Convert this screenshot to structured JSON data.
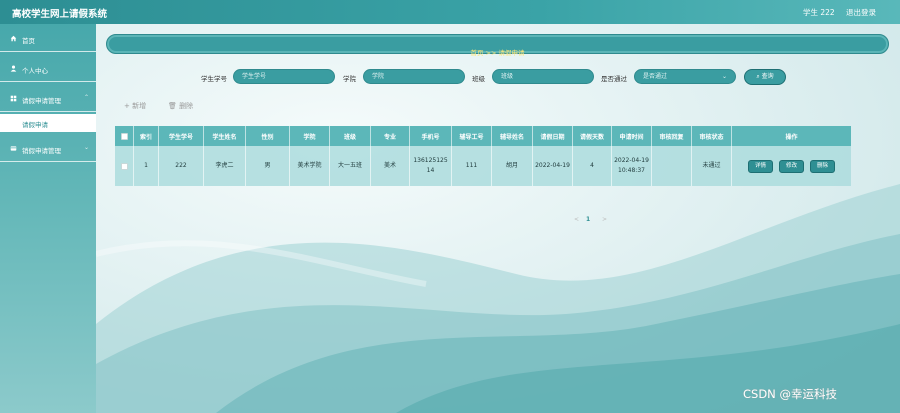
{
  "app": {
    "title": "高校学生网上请假系统",
    "user_label": "学生 222",
    "logout_label": "退出登录"
  },
  "sidebar": {
    "items": [
      {
        "label": "首页",
        "icon": "home-icon"
      },
      {
        "label": "个人中心",
        "icon": "user-icon"
      },
      {
        "label": "请假申请管理",
        "icon": "grid-icon"
      },
      {
        "label": "销假申请管理",
        "icon": "card-icon"
      }
    ],
    "sub_item": "请假申请"
  },
  "breadcrumb": {
    "home": "首页",
    "sep": ">>",
    "current": "请假申请"
  },
  "search": {
    "student_no_label": "学生学号",
    "student_no_placeholder": "学生学号",
    "college_label": "学院",
    "college_placeholder": "学院",
    "class_label": "班级",
    "class_placeholder": "班级",
    "approved_label": "是否通过",
    "approved_value": "是否通过",
    "button_label": "查询"
  },
  "toolbar": {
    "add_label": "新增",
    "delete_label": "删除"
  },
  "table": {
    "headers": [
      "索引",
      "学生学号",
      "学生姓名",
      "性别",
      "学院",
      "班级",
      "专业",
      "手机号",
      "辅导工号",
      "辅导姓名",
      "请假日期",
      "请假天数",
      "申请时间",
      "审核回复",
      "审核状态",
      "操作"
    ],
    "rows": [
      {
        "index": "1",
        "student_no": "222",
        "student_name": "李虎二",
        "gender": "男",
        "college": "美术学院",
        "class": "大一五班",
        "major": "美术",
        "phone": "13612512514",
        "counselor_no": "111",
        "counselor_name": "胡月",
        "leave_date": "2022-04-19",
        "days": "4",
        "apply_time": "2022-04-19 10:48:37",
        "reply": "",
        "status": "未通过",
        "actions": [
          "详情",
          "修改",
          "删除"
        ]
      }
    ]
  },
  "pager": {
    "prev": "<",
    "page": "1",
    "next": ">"
  },
  "watermark": "CSDN @幸运科技",
  "colors": {
    "primary": "#3a9da1",
    "header": "#5cb7b9",
    "crumb_text": "#ffe87a"
  }
}
